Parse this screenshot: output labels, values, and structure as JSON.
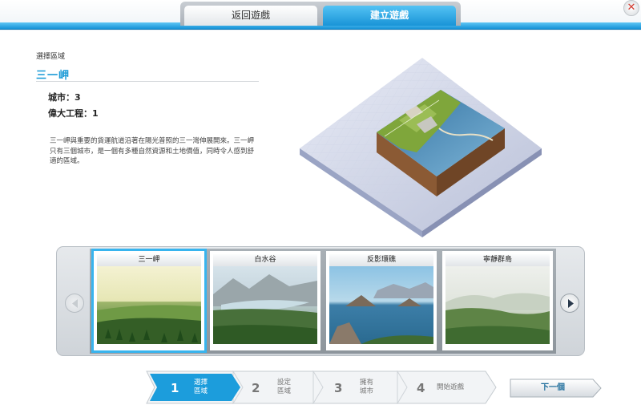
{
  "tabs": {
    "back": "返回遊戲",
    "create": "建立遊戲"
  },
  "close": {
    "icon": "close-icon",
    "glyph": "✕"
  },
  "region": {
    "label": "選擇區域",
    "name": "三一岬",
    "cities": "城市：3",
    "great_works": "偉大工程：1",
    "description": "三一岬與重要的貨運航道沿著在陽光普照的三一灣伸展開來。三一岬只有三個城市，是一個有多種自然資源和土地價值，同時令人感到舒適的區域。"
  },
  "carousel": {
    "cards": [
      {
        "label": "三一岬",
        "selected": true
      },
      {
        "label": "白水谷",
        "selected": false
      },
      {
        "label": "反影環礁",
        "selected": false
      },
      {
        "label": "寧靜群島",
        "selected": false
      }
    ]
  },
  "steps": [
    {
      "num": "1",
      "label": "選擇\n區域",
      "active": true
    },
    {
      "num": "2",
      "label": "設定\n區域",
      "active": false
    },
    {
      "num": "3",
      "label": "擁有\n城市",
      "active": false
    },
    {
      "num": "4",
      "label": "開始遊戲",
      "active": false
    }
  ],
  "next_button": "下一個",
  "colors": {
    "accent": "#1a9ad6",
    "active_step": "#1c9ddc"
  }
}
